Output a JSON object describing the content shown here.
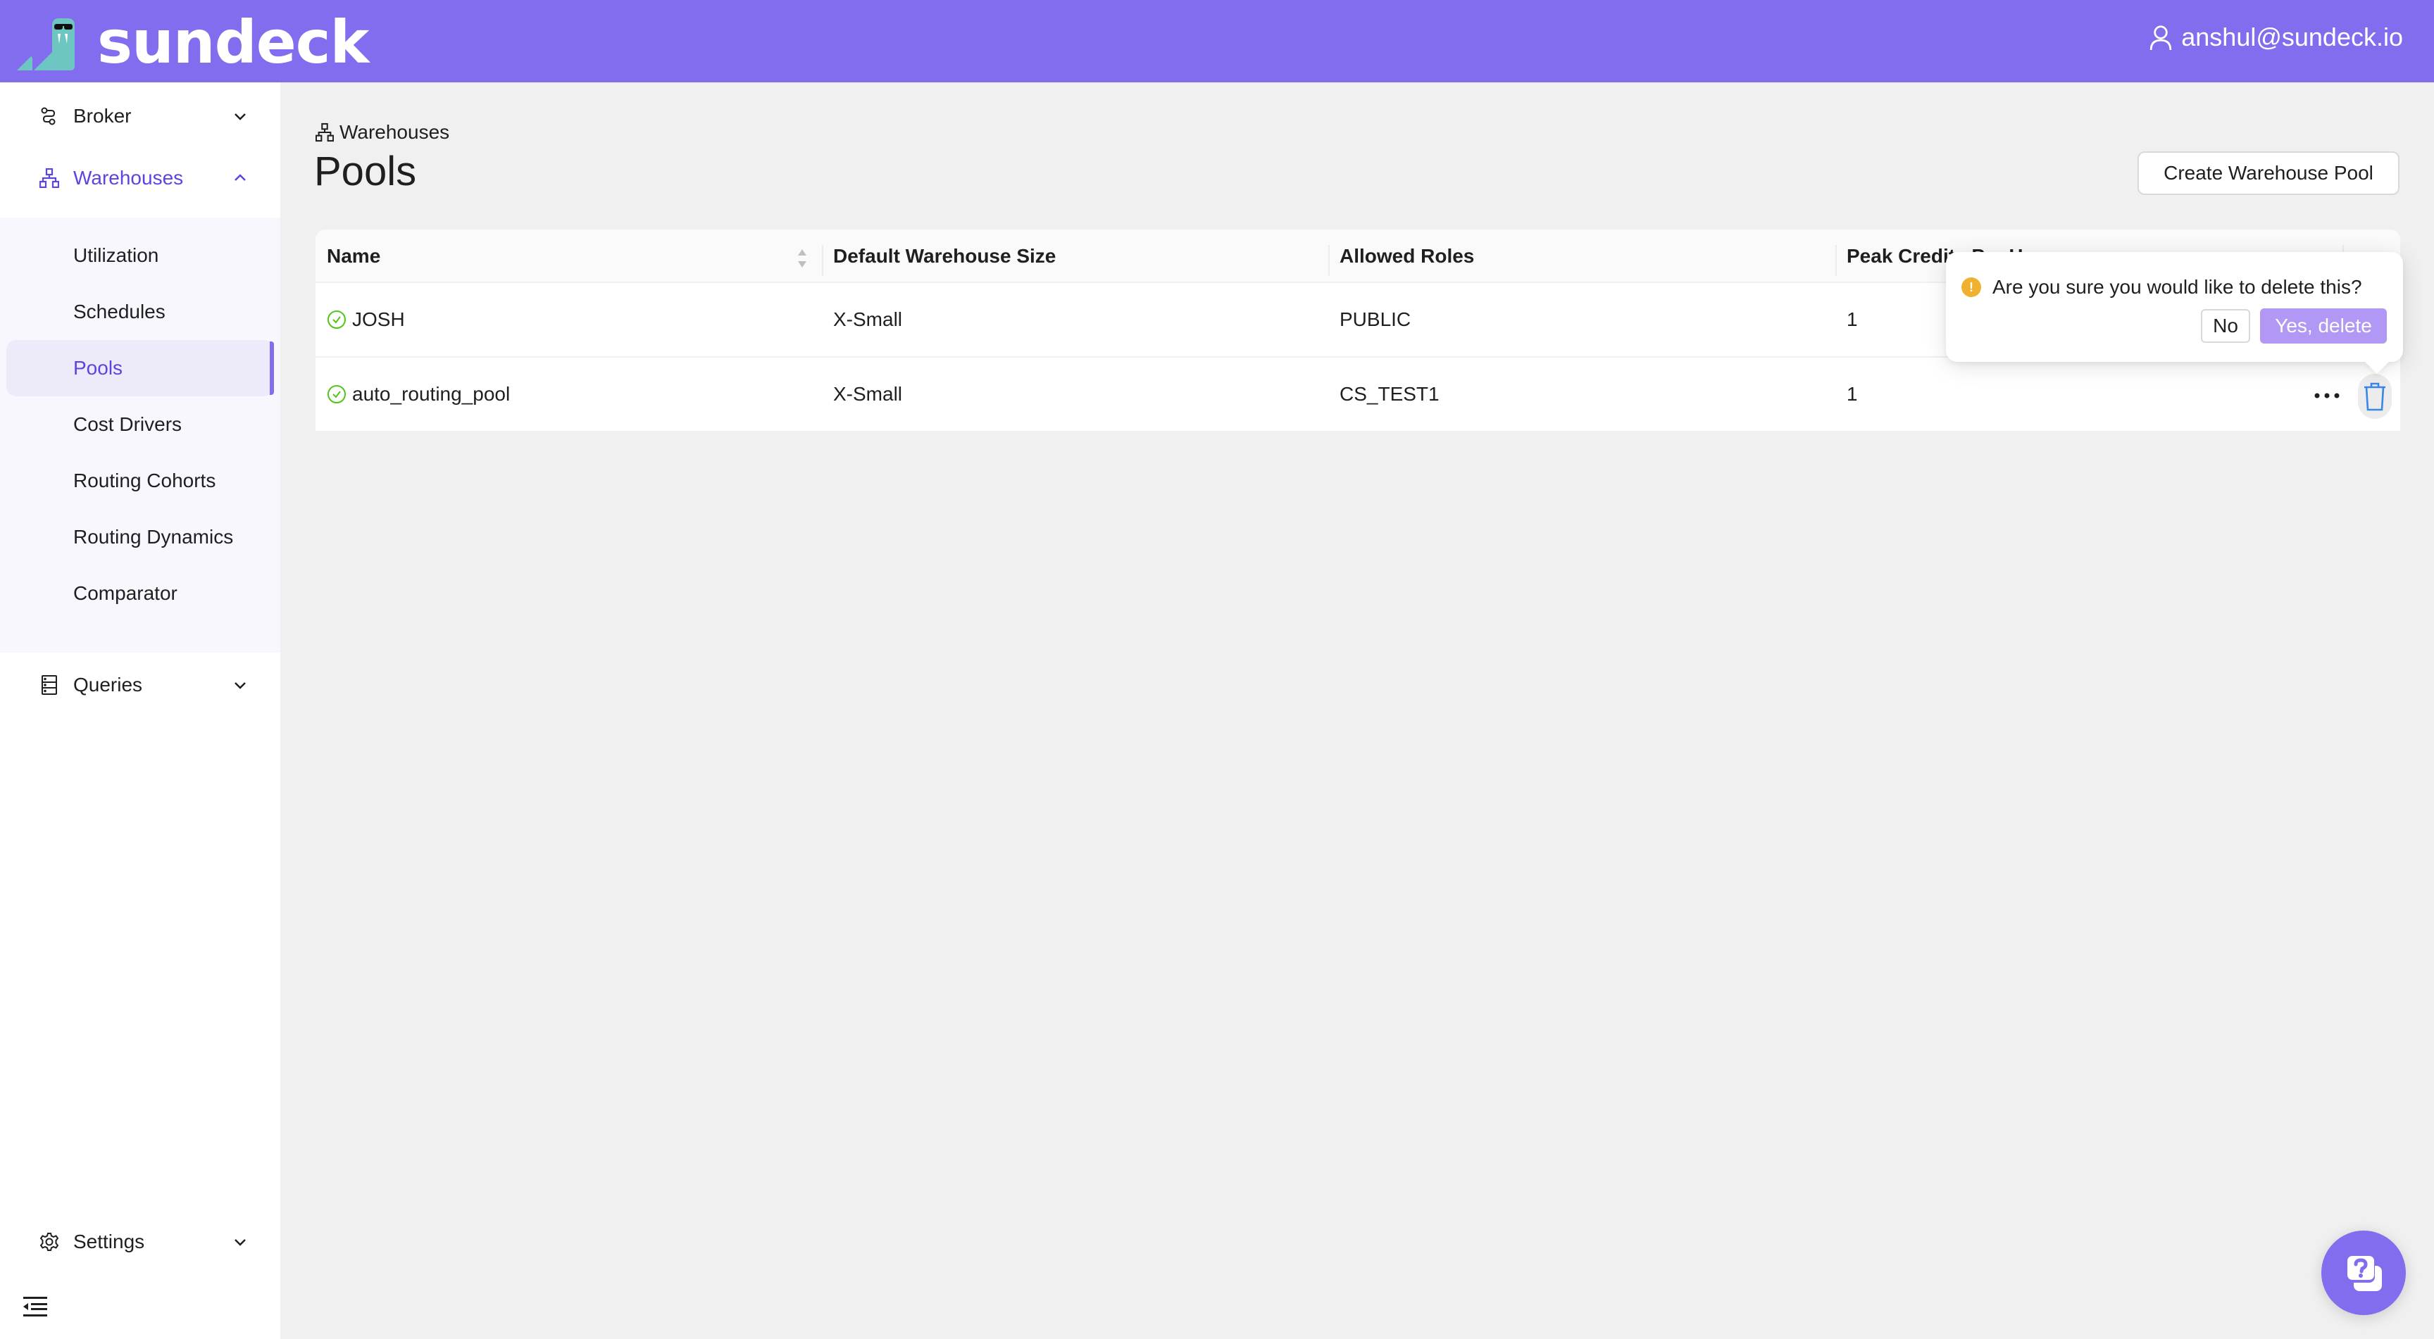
{
  "app": {
    "brand": "sundeck",
    "user_email": "anshul@sundeck.io",
    "colors": {
      "brand_purple": "#816ded",
      "active_text": "#5b45e0",
      "logo_teal": "#6ec6c3",
      "status_green": "#52c41a",
      "danger_blue": "#3a86e8",
      "warning_orange": "#f0b030",
      "confirm_button": "#b198f5"
    }
  },
  "sidebar": {
    "items": [
      {
        "label": "Broker",
        "icon": "broker-route-icon",
        "expanded": false
      },
      {
        "label": "Warehouses",
        "icon": "sitemap-icon",
        "expanded": true,
        "active": true
      },
      {
        "label": "Queries",
        "icon": "database-icon",
        "expanded": false
      },
      {
        "label": "Settings",
        "icon": "gear-icon",
        "expanded": false
      }
    ],
    "warehouses_submenu": [
      {
        "label": "Utilization"
      },
      {
        "label": "Schedules"
      },
      {
        "label": "Pools",
        "selected": true
      },
      {
        "label": "Cost Drivers"
      },
      {
        "label": "Routing Cohorts"
      },
      {
        "label": "Routing Dynamics"
      },
      {
        "label": "Comparator"
      }
    ],
    "collapse_icon": "menu-fold-icon"
  },
  "main": {
    "breadcrumb": "Warehouses",
    "title": "Pools",
    "create_button": "Create Warehouse Pool",
    "table": {
      "columns": [
        "Name",
        "Default Warehouse Size",
        "Allowed Roles",
        "Peak Credits Per Hour"
      ],
      "rows": [
        {
          "status": "active",
          "name": "JOSH",
          "size": "X-Small",
          "roles": "PUBLIC",
          "peak_credits": "1"
        },
        {
          "status": "active",
          "name": "auto_routing_pool",
          "size": "X-Small",
          "roles": "CS_TEST1",
          "peak_credits": "1"
        }
      ]
    }
  },
  "popconfirm": {
    "message": "Are you sure you would like to delete this?",
    "cancel_label": "No",
    "confirm_label": "Yes, delete"
  },
  "help": {
    "icon": "help-chat-icon"
  }
}
